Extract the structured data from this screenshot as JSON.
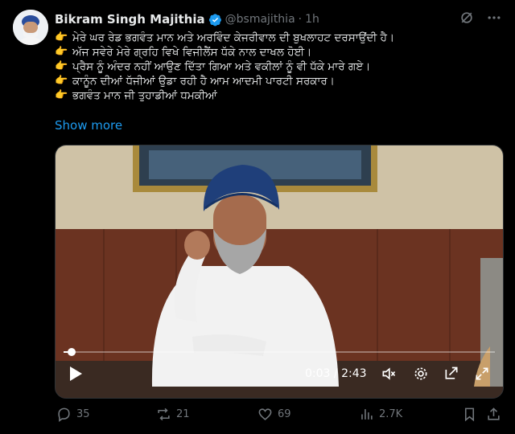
{
  "tweet": {
    "author_name": "Bikram Singh Majithia",
    "handle": "@bsmajithia",
    "separator": "·",
    "time": "1h",
    "lines": [
      "ਮੇਰੇ ਘਰ ਰੇਡ ਭਗਵੰਤ ਮਾਨ ਅਤੇ ਅਰਵਿੰਦ ਕੇਜਰੀਵਾਲ ਦੀ ਬੁਖਲਾਹਟ ਦਰਸਾਉਂਦੀ ਹੈ।",
      "ਅੱਜ ਸਵੇਰੇ ਮੇਰੇ ਗ੍ਰਹਿ ਵਿਖੇ ਵਿਜੀਲੈਂਸ ਧੱਕੇ ਨਾਲ ਦਾਖਲ ਹੋਈ।",
      "ਪ੍ਰੈਸ ਨੂੰ ਅੰਦਰ ਨਹੀਂ ਆਉਣ ਦਿੱਤਾ ਗਿਆ ਅਤੇ ਵਕੀਲਾਂ ਨੂੰ ਵੀ ਧੱਕੇ ਮਾਰੇ ਗਏ।",
      "ਕਾਨੂੰਨ ਦੀਆਂ ਧੱਜੀਆਂ ਉਡਾ ਰਹੀ ਹੈ ਆਮ ਆਦਮੀ ਪਾਰਟੀ ਸਰਕਾਰ।",
      "ਭਗਵੰਤ ਮਾਨ ਜੀ ਤੁਹਾਡੀਆਂ ਧਮਕੀਆਂ"
    ],
    "bullet_emoji": "👉",
    "show_more": "Show more"
  },
  "video": {
    "current_time": "0:03",
    "time_separator": " / ",
    "duration": "2:43",
    "progress_fraction": 0.018
  },
  "actions": {
    "replies": "35",
    "reposts": "21",
    "likes": "69",
    "views": "2.7K"
  },
  "colors": {
    "background": "#000000",
    "text": "#e7e9ea",
    "muted": "#71767b",
    "link": "#1d9bf0",
    "verified": "#1d9bf0"
  }
}
